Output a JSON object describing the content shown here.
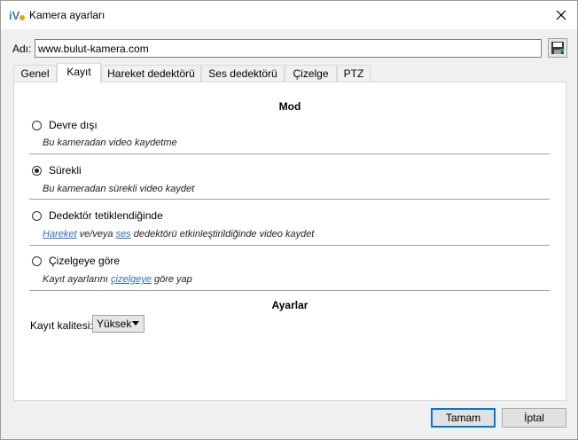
{
  "window": {
    "title": "Kamera ayarları"
  },
  "name_field": {
    "label": "Adı:",
    "value": "www.bulut-kamera.com"
  },
  "tabs": [
    {
      "label": "Genel",
      "active": false
    },
    {
      "label": "Kayıt",
      "active": true
    },
    {
      "label": "Hareket dedektörü",
      "active": false
    },
    {
      "label": "Ses dedektörü",
      "active": false
    },
    {
      "label": "Çizelge",
      "active": false
    },
    {
      "label": "PTZ",
      "active": false
    }
  ],
  "mode": {
    "title": "Mod",
    "options": [
      {
        "label": "Devre dışı",
        "selected": false,
        "desc": "Bu kameradan video kaydetme"
      },
      {
        "label": "Sürekli",
        "selected": true,
        "desc": "Bu kameradan sürekli video kaydet"
      },
      {
        "label": "Dedektör tetiklendiğinde",
        "selected": false,
        "desc_link1": "Hareket",
        "desc_mid": " ve/veya ",
        "desc_link2": "ses",
        "desc_rest": " dedektörü etkinleştirildiğinde video kaydet"
      },
      {
        "label": "Çizelgeye göre",
        "selected": false,
        "desc_pre": "Kayıt ayarlarını ",
        "desc_link": "çizelgeye",
        "desc_post": " göre yap"
      }
    ]
  },
  "settings": {
    "title": "Ayarlar",
    "quality_label": "Kayıt kalitesi:",
    "quality_value": "Yüksek"
  },
  "buttons": {
    "ok": "Tamam",
    "cancel": "İptal"
  },
  "colors": {
    "accent": "#0078d7",
    "link": "#2a6ebb"
  }
}
